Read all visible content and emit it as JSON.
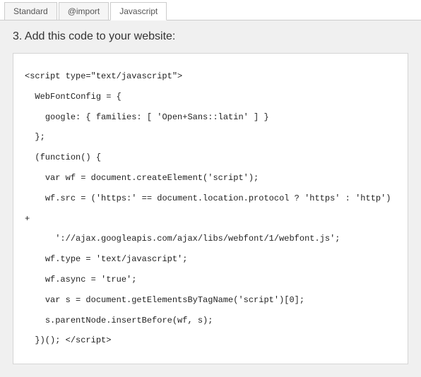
{
  "tabs": [
    {
      "label": "Standard",
      "active": false
    },
    {
      "label": "@import",
      "active": false
    },
    {
      "label": "Javascript",
      "active": true
    }
  ],
  "instruction": "3. Add this code to your website:",
  "code": "<script type=\"text/javascript\">\n  WebFontConfig = {\n    google: { families: [ 'Open+Sans::latin' ] }\n  };\n  (function() {\n    var wf = document.createElement('script');\n    wf.src = ('https:' == document.location.protocol ? 'https' : 'http') +\n      '://ajax.googleapis.com/ajax/libs/webfont/1/webfont.js';\n    wf.type = 'text/javascript';\n    wf.async = 'true';\n    var s = document.getElementsByTagName('script')[0];\n    s.parentNode.insertBefore(wf, s);\n  })(); </script>"
}
